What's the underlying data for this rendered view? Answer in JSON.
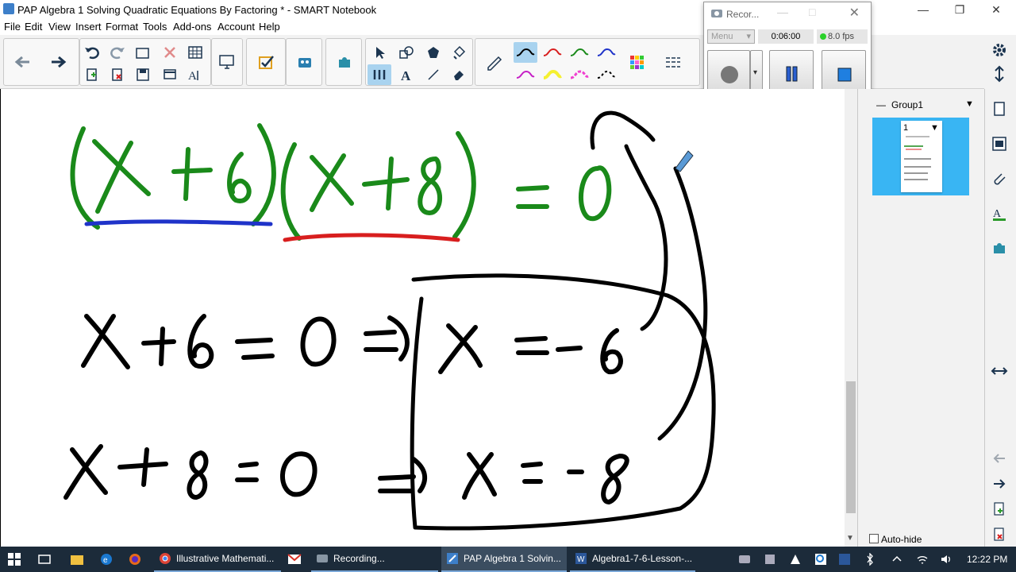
{
  "window": {
    "title": "PAP Algebra 1 Solving Quadratic Equations By Factoring * - SMART Notebook",
    "minimize": "—",
    "maximize": "❐",
    "close": "✕"
  },
  "menu": [
    "File",
    "Edit",
    "View",
    "Insert",
    "Format",
    "Tools",
    "Add-ons",
    "Account",
    "Help"
  ],
  "recorder": {
    "title": "Recor...",
    "menu_label": "Menu",
    "elapsed": "0:06:00",
    "fps": "8.0 fps"
  },
  "side_panel": {
    "group_label": "Group1",
    "page_number": "1",
    "autohide_label": "Auto-hide"
  },
  "canvas": {
    "ink_colors": {
      "green": "#1a8a1a",
      "blue": "#1f33c9",
      "red": "#d81e1e",
      "black": "#000000"
    },
    "equations": [
      "(x+6)(x+8) = 0",
      "x+6 = 0 => x = -6",
      "x+8 = 0 => x = -8"
    ]
  },
  "taskbar": {
    "items": [
      {
        "label": "Illustrative Mathemati...",
        "icon": "chrome-icon"
      },
      {
        "label": "Recording...",
        "icon": "recorder-icon"
      },
      {
        "label": "PAP Algebra 1 Solvin...",
        "icon": "smart-notebook-icon"
      },
      {
        "label": "Algebra1-7-6-Lesson-...",
        "icon": "word-icon"
      }
    ],
    "clock": "12:22 PM"
  }
}
